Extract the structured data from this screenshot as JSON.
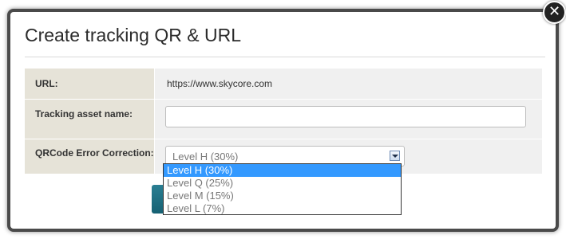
{
  "dialog": {
    "title": "Create tracking QR & URL",
    "close_glyph": "✕"
  },
  "form": {
    "url_label": "URL:",
    "url_value": "https://www.skycore.com",
    "asset_label": "Tracking asset name:",
    "asset_value": "",
    "ecc_label": "QRCode Error Correction:",
    "ecc_selected": "Level H (30%)",
    "ecc_options": [
      "Level H (30%)",
      "Level Q (25%)",
      "Level M (15%)",
      "Level L (7%)"
    ]
  },
  "colors": {
    "selected_option_bg": "#3399ff",
    "submit_button": "#1e7082"
  }
}
